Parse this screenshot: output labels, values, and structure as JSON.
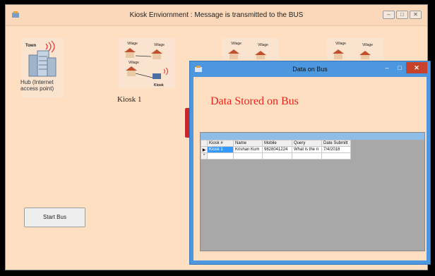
{
  "main_window": {
    "title": "Kiosk Enviornment : Message is transmitted to the BUS",
    "controls": {
      "minimize": "–",
      "maximize": "□",
      "close": "✕"
    }
  },
  "hub": {
    "tile_text": "Town",
    "label": "Hub (Internet access point)",
    "icon": "server-tower-wifi-icon"
  },
  "kiosks": [
    {
      "label": "Kiosk 1",
      "village_labels": [
        "Village",
        "Village",
        "Village"
      ],
      "kiosk_text": "Kiosk"
    },
    {
      "village_labels": [
        "Village",
        "Village"
      ]
    },
    {
      "village_labels": [
        "Village",
        "Village"
      ]
    }
  ],
  "start_button": "Start Bus",
  "child_window": {
    "title": "Data on Bus",
    "controls": {
      "minimize": "–",
      "maximize": "□",
      "close": "✕"
    },
    "heading": "Data Stored on Bus",
    "grid": {
      "columns": [
        "Kiosk #",
        "Name",
        "Mobile",
        "Query",
        "Date Submitt"
      ],
      "rows": [
        {
          "row_header": "▶",
          "cells": [
            "Kiosk 1",
            "Krishan Kum",
            "9828041224",
            "What is the n",
            "7/4/2018"
          ]
        },
        {
          "row_header": "*",
          "cells": [
            "",
            "",
            "",
            "",
            ""
          ]
        }
      ]
    }
  },
  "colors": {
    "background": "#ffdfc2",
    "heading": "#e8241b",
    "child_frame": "#4d97de",
    "bus": "#c8262b"
  }
}
